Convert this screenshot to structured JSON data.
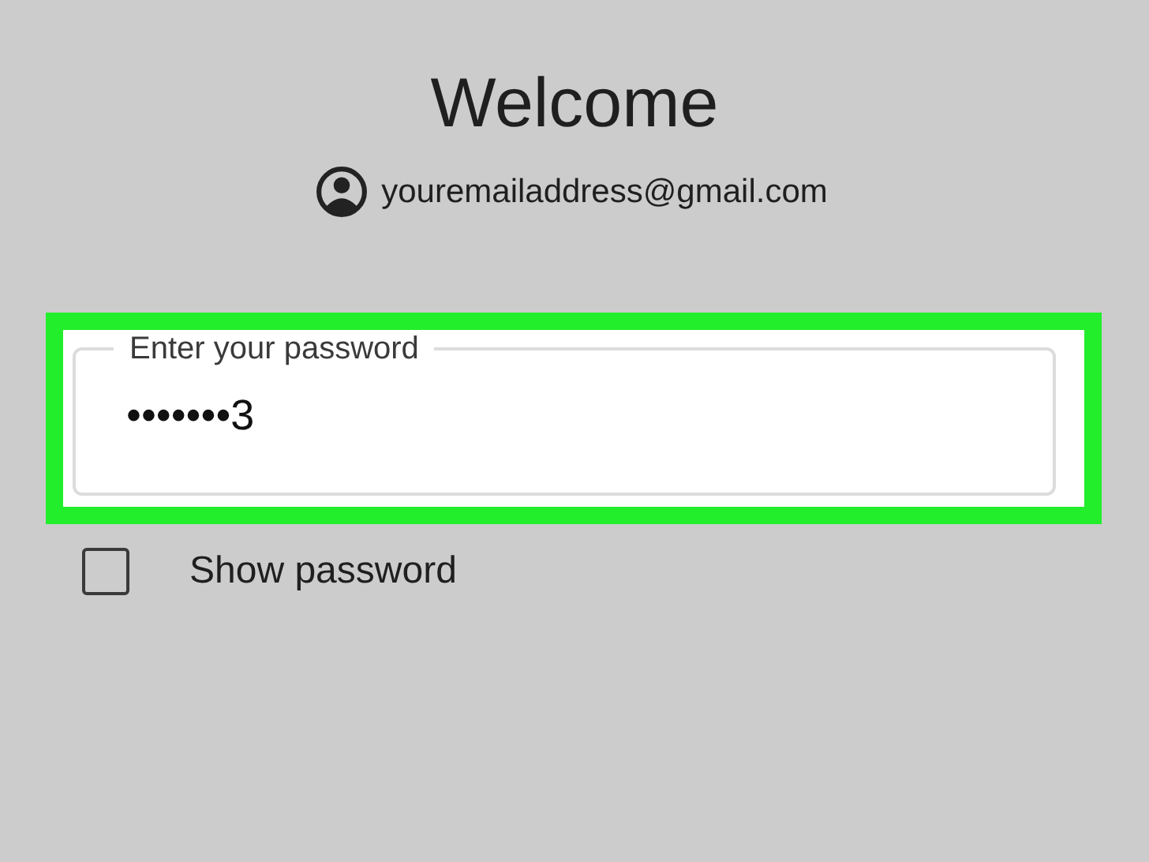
{
  "title": "Welcome",
  "account": {
    "email": "youremailaddress@gmail.com"
  },
  "password_field": {
    "label": "Enter your password",
    "value": "•••••••3",
    "highlighted": true
  },
  "show_password": {
    "label": "Show password",
    "checked": false
  }
}
